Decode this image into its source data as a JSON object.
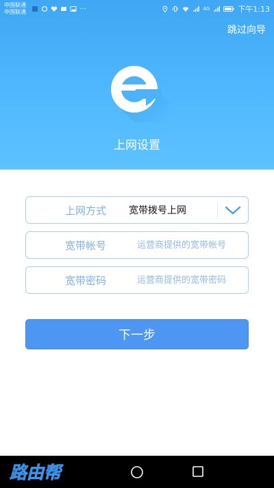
{
  "status_bar": {
    "carrier_1": "中国联通",
    "carrier_2": "中国联通",
    "more_dots": "···",
    "network_type": "4G",
    "time": "下午1:13"
  },
  "header": {
    "skip_label": "跳过向导",
    "title": "上网设置",
    "logo_icon": "e-logo-icon"
  },
  "form": {
    "connection_type": {
      "label": "上网方式",
      "selected": "宽带拨号上网",
      "dropdown_icon": "chevron-down-icon"
    },
    "account": {
      "label": "宽带帐号",
      "placeholder": "运营商提供的宽带帐号",
      "value": ""
    },
    "password": {
      "label": "宽带密码",
      "placeholder": "运营商提供的宽带密码",
      "value": ""
    }
  },
  "next_button_label": "下一步",
  "watermark": "路由帮",
  "colors": {
    "hero_top": "#3fa7f3",
    "hero_bottom": "#5ec2ff",
    "field_border": "#a9cdf2",
    "label": "#7fb0e0",
    "button": "#4d96f4",
    "navbar": "#000000"
  }
}
